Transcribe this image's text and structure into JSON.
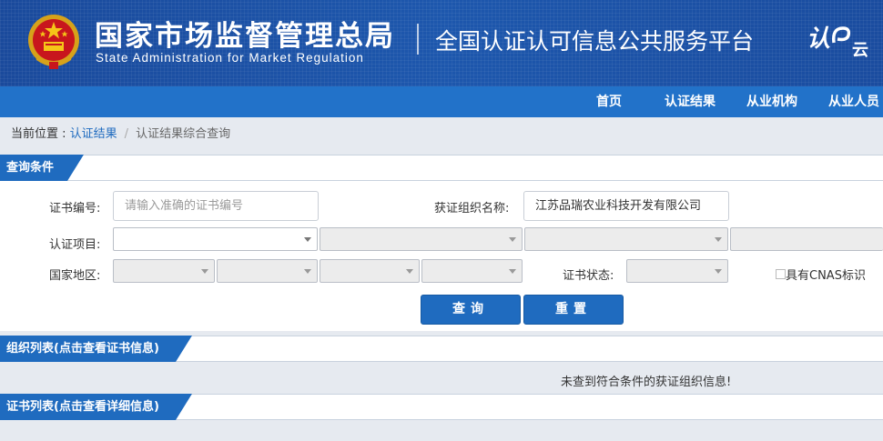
{
  "header": {
    "title_cn": "国家市场监督管理总局",
    "title_en": "State Administration  for  Market Regulation",
    "platform": "全国认证认可信息公共服务平台",
    "logo_text": "认",
    "logo_sub": "云"
  },
  "nav": {
    "items": [
      {
        "label": "首页"
      },
      {
        "label": "认证结果"
      },
      {
        "label": "从业机构"
      },
      {
        "label": "从业人员"
      }
    ]
  },
  "breadcrumb": {
    "prefix": "当前位置 : ",
    "link": "认证结果",
    "sep": "/",
    "current": "认证结果综合查询"
  },
  "query": {
    "section_title": "查询条件",
    "cert_no_label": "证书编号:",
    "cert_no_placeholder": "请输入准确的证书编号",
    "cert_no_value": "",
    "org_name_label": "获证组织名称:",
    "org_name_value": "江苏品瑞农业科技开发有限公司",
    "cert_project_label": "认证项目:",
    "region_label": "国家地区:",
    "cert_status_label": "证书状态:",
    "cnas_label": "具有CNAS标识",
    "search_button": "查询",
    "reset_button": "重置"
  },
  "org_list": {
    "section_title": "组织列表(点击查看证书信息)",
    "empty_message": "未查到符合条件的获证组织信息!"
  },
  "cert_list": {
    "section_title": "证书列表(点击查看详细信息)"
  }
}
